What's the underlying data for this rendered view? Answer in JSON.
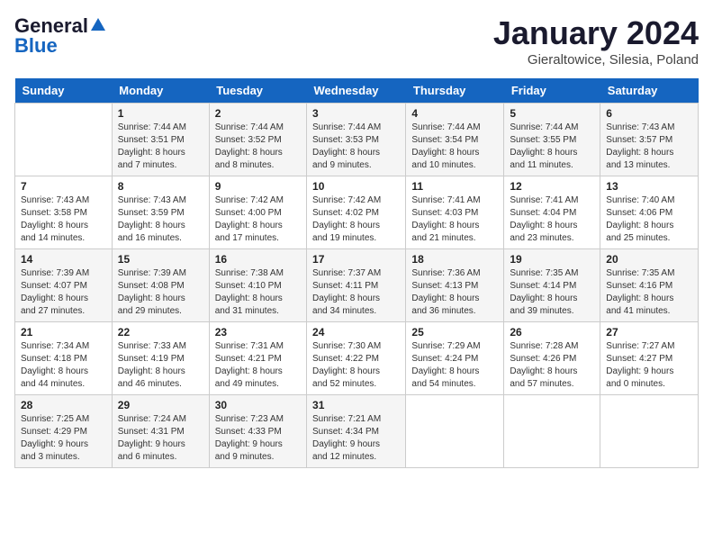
{
  "logo": {
    "line1": "General",
    "line2": "Blue"
  },
  "title": "January 2024",
  "location": "Gieraltowice, Silesia, Poland",
  "weekdays": [
    "Sunday",
    "Monday",
    "Tuesday",
    "Wednesday",
    "Thursday",
    "Friday",
    "Saturday"
  ],
  "weeks": [
    [
      {
        "day": "",
        "content": ""
      },
      {
        "day": "1",
        "content": "Sunrise: 7:44 AM\nSunset: 3:51 PM\nDaylight: 8 hours\nand 7 minutes."
      },
      {
        "day": "2",
        "content": "Sunrise: 7:44 AM\nSunset: 3:52 PM\nDaylight: 8 hours\nand 8 minutes."
      },
      {
        "day": "3",
        "content": "Sunrise: 7:44 AM\nSunset: 3:53 PM\nDaylight: 8 hours\nand 9 minutes."
      },
      {
        "day": "4",
        "content": "Sunrise: 7:44 AM\nSunset: 3:54 PM\nDaylight: 8 hours\nand 10 minutes."
      },
      {
        "day": "5",
        "content": "Sunrise: 7:44 AM\nSunset: 3:55 PM\nDaylight: 8 hours\nand 11 minutes."
      },
      {
        "day": "6",
        "content": "Sunrise: 7:43 AM\nSunset: 3:57 PM\nDaylight: 8 hours\nand 13 minutes."
      }
    ],
    [
      {
        "day": "7",
        "content": "Sunrise: 7:43 AM\nSunset: 3:58 PM\nDaylight: 8 hours\nand 14 minutes."
      },
      {
        "day": "8",
        "content": "Sunrise: 7:43 AM\nSunset: 3:59 PM\nDaylight: 8 hours\nand 16 minutes."
      },
      {
        "day": "9",
        "content": "Sunrise: 7:42 AM\nSunset: 4:00 PM\nDaylight: 8 hours\nand 17 minutes."
      },
      {
        "day": "10",
        "content": "Sunrise: 7:42 AM\nSunset: 4:02 PM\nDaylight: 8 hours\nand 19 minutes."
      },
      {
        "day": "11",
        "content": "Sunrise: 7:41 AM\nSunset: 4:03 PM\nDaylight: 8 hours\nand 21 minutes."
      },
      {
        "day": "12",
        "content": "Sunrise: 7:41 AM\nSunset: 4:04 PM\nDaylight: 8 hours\nand 23 minutes."
      },
      {
        "day": "13",
        "content": "Sunrise: 7:40 AM\nSunset: 4:06 PM\nDaylight: 8 hours\nand 25 minutes."
      }
    ],
    [
      {
        "day": "14",
        "content": "Sunrise: 7:39 AM\nSunset: 4:07 PM\nDaylight: 8 hours\nand 27 minutes."
      },
      {
        "day": "15",
        "content": "Sunrise: 7:39 AM\nSunset: 4:08 PM\nDaylight: 8 hours\nand 29 minutes."
      },
      {
        "day": "16",
        "content": "Sunrise: 7:38 AM\nSunset: 4:10 PM\nDaylight: 8 hours\nand 31 minutes."
      },
      {
        "day": "17",
        "content": "Sunrise: 7:37 AM\nSunset: 4:11 PM\nDaylight: 8 hours\nand 34 minutes."
      },
      {
        "day": "18",
        "content": "Sunrise: 7:36 AM\nSunset: 4:13 PM\nDaylight: 8 hours\nand 36 minutes."
      },
      {
        "day": "19",
        "content": "Sunrise: 7:35 AM\nSunset: 4:14 PM\nDaylight: 8 hours\nand 39 minutes."
      },
      {
        "day": "20",
        "content": "Sunrise: 7:35 AM\nSunset: 4:16 PM\nDaylight: 8 hours\nand 41 minutes."
      }
    ],
    [
      {
        "day": "21",
        "content": "Sunrise: 7:34 AM\nSunset: 4:18 PM\nDaylight: 8 hours\nand 44 minutes."
      },
      {
        "day": "22",
        "content": "Sunrise: 7:33 AM\nSunset: 4:19 PM\nDaylight: 8 hours\nand 46 minutes."
      },
      {
        "day": "23",
        "content": "Sunrise: 7:31 AM\nSunset: 4:21 PM\nDaylight: 8 hours\nand 49 minutes."
      },
      {
        "day": "24",
        "content": "Sunrise: 7:30 AM\nSunset: 4:22 PM\nDaylight: 8 hours\nand 52 minutes."
      },
      {
        "day": "25",
        "content": "Sunrise: 7:29 AM\nSunset: 4:24 PM\nDaylight: 8 hours\nand 54 minutes."
      },
      {
        "day": "26",
        "content": "Sunrise: 7:28 AM\nSunset: 4:26 PM\nDaylight: 8 hours\nand 57 minutes."
      },
      {
        "day": "27",
        "content": "Sunrise: 7:27 AM\nSunset: 4:27 PM\nDaylight: 9 hours\nand 0 minutes."
      }
    ],
    [
      {
        "day": "28",
        "content": "Sunrise: 7:25 AM\nSunset: 4:29 PM\nDaylight: 9 hours\nand 3 minutes."
      },
      {
        "day": "29",
        "content": "Sunrise: 7:24 AM\nSunset: 4:31 PM\nDaylight: 9 hours\nand 6 minutes."
      },
      {
        "day": "30",
        "content": "Sunrise: 7:23 AM\nSunset: 4:33 PM\nDaylight: 9 hours\nand 9 minutes."
      },
      {
        "day": "31",
        "content": "Sunrise: 7:21 AM\nSunset: 4:34 PM\nDaylight: 9 hours\nand 12 minutes."
      },
      {
        "day": "",
        "content": ""
      },
      {
        "day": "",
        "content": ""
      },
      {
        "day": "",
        "content": ""
      }
    ]
  ]
}
